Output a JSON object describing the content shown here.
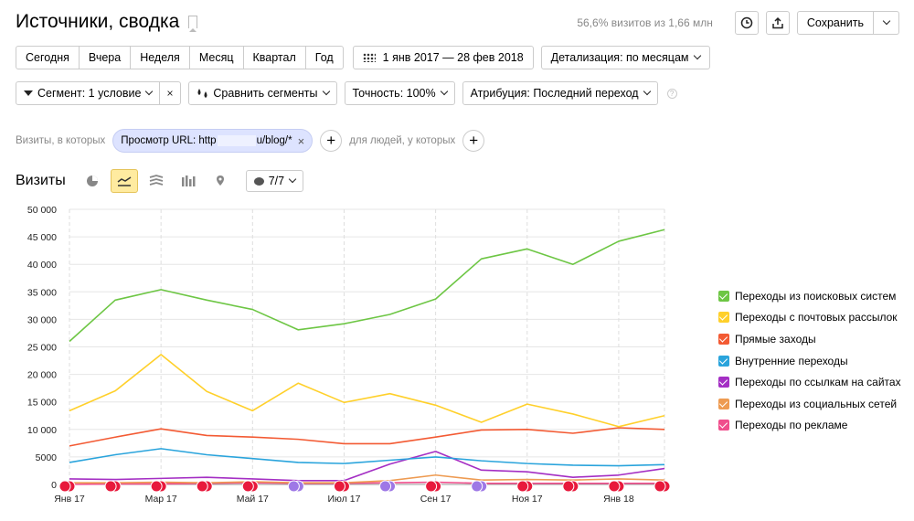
{
  "header": {
    "title": "Источники, сводка",
    "visits_info": "56,6% визитов из 1,66 млн",
    "save_label": "Сохранить"
  },
  "periods": [
    "Сегодня",
    "Вчера",
    "Неделя",
    "Месяц",
    "Квартал",
    "Год"
  ],
  "date_range": "1 янв 2017 — 28 фев 2018",
  "detail": "Детализация: по месяцам",
  "filters": {
    "segment": "Сегмент: 1 условие",
    "compare": "Сравнить сегменты",
    "accuracy": "Точность: 100%",
    "attribution": "Атрибуция: Последний переход"
  },
  "condition": {
    "prefix": "Визиты, в которых",
    "chip_start": "Просмотр URL: http",
    "chip_end": "u/blog/*",
    "suffix": "для людей, у которых"
  },
  "section": {
    "title": "Визиты",
    "counter": "7/7"
  },
  "chart_data": {
    "type": "line",
    "categories": [
      "Янв 17",
      "Фев 17",
      "Мар 17",
      "Апр 17",
      "Май 17",
      "Июн 17",
      "Июл 17",
      "Авг 17",
      "Сен 17",
      "Окт 17",
      "Ноя 17",
      "Дек 17",
      "Янв 18",
      "Фев 18"
    ],
    "x_tick_labels": [
      "Янв 17",
      "Мар 17",
      "Май 17",
      "Июл 17",
      "Сен 17",
      "Ноя 17",
      "Янв 18"
    ],
    "ylim": [
      0,
      50000
    ],
    "y_tick_labels": [
      "0",
      "5000",
      "10 000",
      "15 000",
      "20 000",
      "25 000",
      "30 000",
      "35 000",
      "40 000",
      "45 000",
      "50 000"
    ],
    "series": [
      {
        "name": "Переходы из поисковых систем",
        "color": "#6dc644",
        "values": [
          26000,
          33500,
          35400,
          33500,
          31800,
          28100,
          29200,
          30900,
          33700,
          41000,
          42800,
          40000,
          44200,
          46300
        ]
      },
      {
        "name": "Переходы с почтовых рассылок",
        "color": "#ffd02b",
        "values": [
          13400,
          17000,
          23600,
          16900,
          13400,
          18400,
          14900,
          16500,
          14400,
          11300,
          14600,
          12800,
          10500,
          12500
        ]
      },
      {
        "name": "Прямые заходы",
        "color": "#f35a33",
        "values": [
          7000,
          8600,
          10100,
          8900,
          8600,
          8200,
          7400,
          7400,
          8600,
          9900,
          10000,
          9300,
          10300,
          10000
        ]
      },
      {
        "name": "Внутренние переходы",
        "color": "#2aa4dc",
        "values": [
          4000,
          5400,
          6500,
          5400,
          4700,
          4000,
          3800,
          4400,
          5000,
          4300,
          3800,
          3500,
          3400,
          3600
        ]
      },
      {
        "name": "Переходы по ссылкам на сайтах",
        "color": "#a42fc4",
        "values": [
          1000,
          900,
          1100,
          1300,
          1000,
          700,
          700,
          3700,
          6000,
          2600,
          2300,
          1300,
          1700,
          2900
        ]
      },
      {
        "name": "Переходы из социальных сетей",
        "color": "#ee9b52",
        "values": [
          300,
          300,
          400,
          300,
          500,
          300,
          300,
          700,
          1700,
          800,
          900,
          800,
          1000,
          800
        ]
      },
      {
        "name": "Переходы по рекламе",
        "color": "#f04e8c",
        "values": [
          0,
          100,
          100,
          200,
          300,
          200,
          200,
          300,
          400,
          200,
          200,
          200,
          200,
          200
        ]
      }
    ]
  }
}
